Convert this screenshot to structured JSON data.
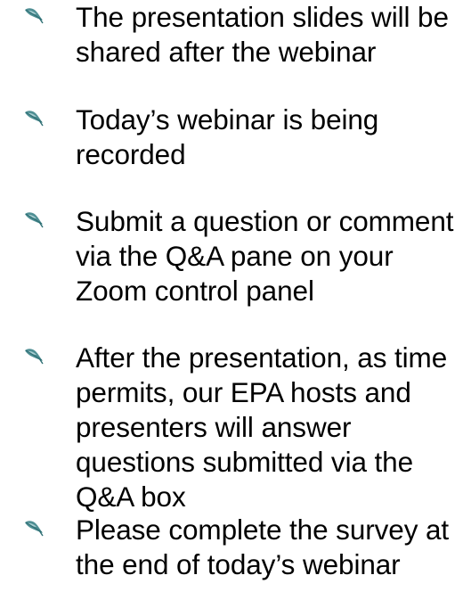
{
  "bullet_icon": "leaf-bullet-icon",
  "colors": {
    "bullet_icon_primary": "#4f8f94",
    "bullet_icon_light": "#a9cfd2",
    "text": "#000000",
    "background": "#ffffff"
  },
  "bullets": [
    {
      "text": "The presentation slides will be shared after the webinar"
    },
    {
      "text": "Today’s webinar is being recorded"
    },
    {
      "text": "Submit a question or comment via the Q&A pane on your Zoom control panel"
    },
    {
      "text": "After the presentation, as time permits, our EPA hosts and presenters will answer questions submitted via the Q&A box"
    },
    {
      "text": "Please complete the survey at the end of today’s webinar"
    }
  ]
}
